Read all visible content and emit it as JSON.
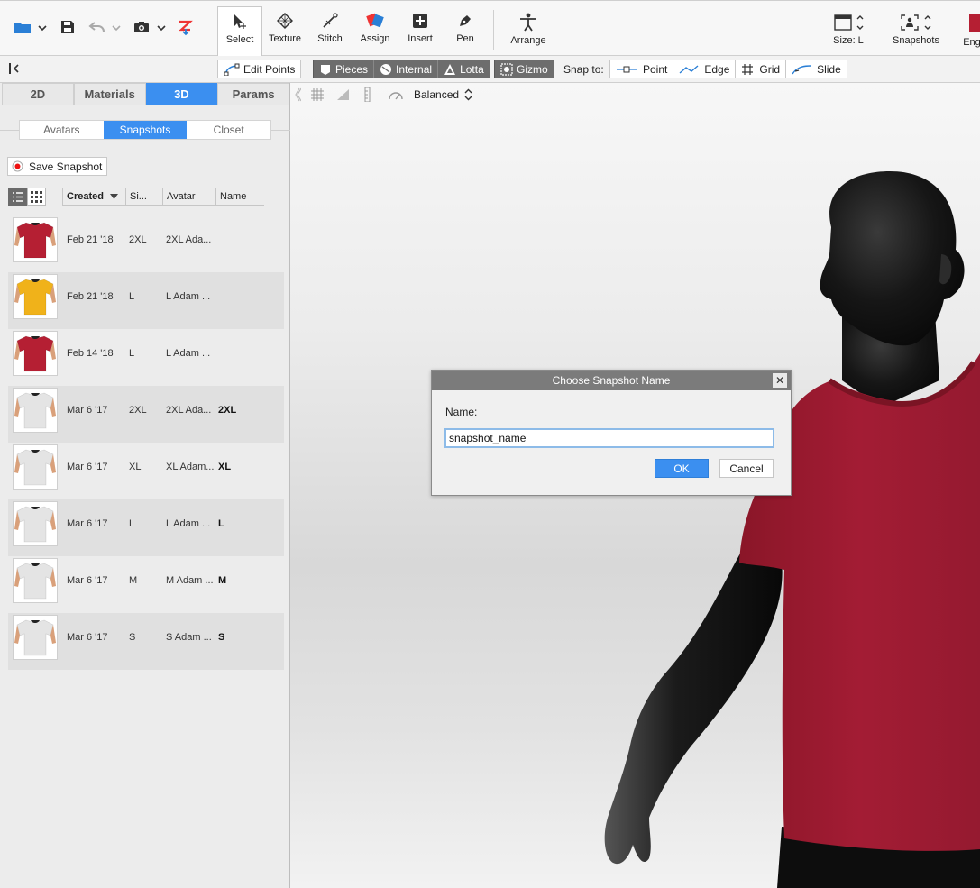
{
  "toolbar": {
    "tools": [
      {
        "label": "Select",
        "icon": "select-icon",
        "active": true
      },
      {
        "label": "Texture",
        "icon": "texture-icon"
      },
      {
        "label": "Stitch",
        "icon": "stitch-icon"
      },
      {
        "label": "Assign",
        "icon": "assign-icon"
      },
      {
        "label": "Insert",
        "icon": "insert-icon"
      },
      {
        "label": "Pen",
        "icon": "pen-icon"
      },
      {
        "label": "Arrange",
        "icon": "arrange-icon"
      }
    ],
    "size_label": "Size: L",
    "snapshots_label": "Snapshots",
    "eng_label": "Eng"
  },
  "secondary_bar": {
    "edit_points": "Edit Points",
    "pieces": "Pieces",
    "internal": "Internal",
    "lotta": "Lotta",
    "gizmo": "Gizmo",
    "snap_to": "Snap to:",
    "point": "Point",
    "edge": "Edge",
    "grid": "Grid",
    "slide": "Slide"
  },
  "left_panel": {
    "main_tabs": [
      {
        "label": "2D"
      },
      {
        "label": "Materials"
      },
      {
        "label": "3D",
        "active": true
      },
      {
        "label": "Params"
      }
    ],
    "sub_tabs": [
      {
        "label": "Avatars"
      },
      {
        "label": "Snapshots",
        "active": true
      },
      {
        "label": "Closet"
      }
    ],
    "save_snapshot": "Save Snapshot",
    "columns": {
      "created": "Created",
      "size": "Si...",
      "avatar": "Avatar",
      "name": "Name"
    },
    "rows": [
      {
        "created": "Feb 21 '18",
        "size": "2XL",
        "avatar": "2XL Ada...",
        "name": "",
        "color": "#b51f33"
      },
      {
        "created": "Feb 21 '18",
        "size": "L",
        "avatar": "L Adam ...",
        "name": "",
        "color": "#f0b21a"
      },
      {
        "created": "Feb 14 '18",
        "size": "L",
        "avatar": "L Adam ...",
        "name": "",
        "color": "#b51f33"
      },
      {
        "created": "Mar 6 '17",
        "size": "2XL",
        "avatar": "2XL Ada...",
        "name": "2XL",
        "color": "#e4e4e4"
      },
      {
        "created": "Mar 6 '17",
        "size": "XL",
        "avatar": "XL Adam...",
        "name": "XL",
        "color": "#e4e4e4"
      },
      {
        "created": "Mar 6 '17",
        "size": "L",
        "avatar": "L Adam ...",
        "name": "L",
        "color": "#e4e4e4"
      },
      {
        "created": "Mar 6 '17",
        "size": "M",
        "avatar": "M Adam ...",
        "name": "M",
        "color": "#e4e4e4"
      },
      {
        "created": "Mar 6 '17",
        "size": "S",
        "avatar": "S Adam ...",
        "name": "S",
        "color": "#e4e4e4"
      }
    ]
  },
  "viewport": {
    "quality": "Balanced"
  },
  "dialog": {
    "title": "Choose Snapshot Name",
    "name_label": "Name:",
    "name_value": "snapshot_name",
    "ok": "OK",
    "cancel": "Cancel"
  },
  "colors": {
    "accent": "#3b8ff0",
    "shirt_red": "#a31c34",
    "mannequin": "#111111"
  }
}
